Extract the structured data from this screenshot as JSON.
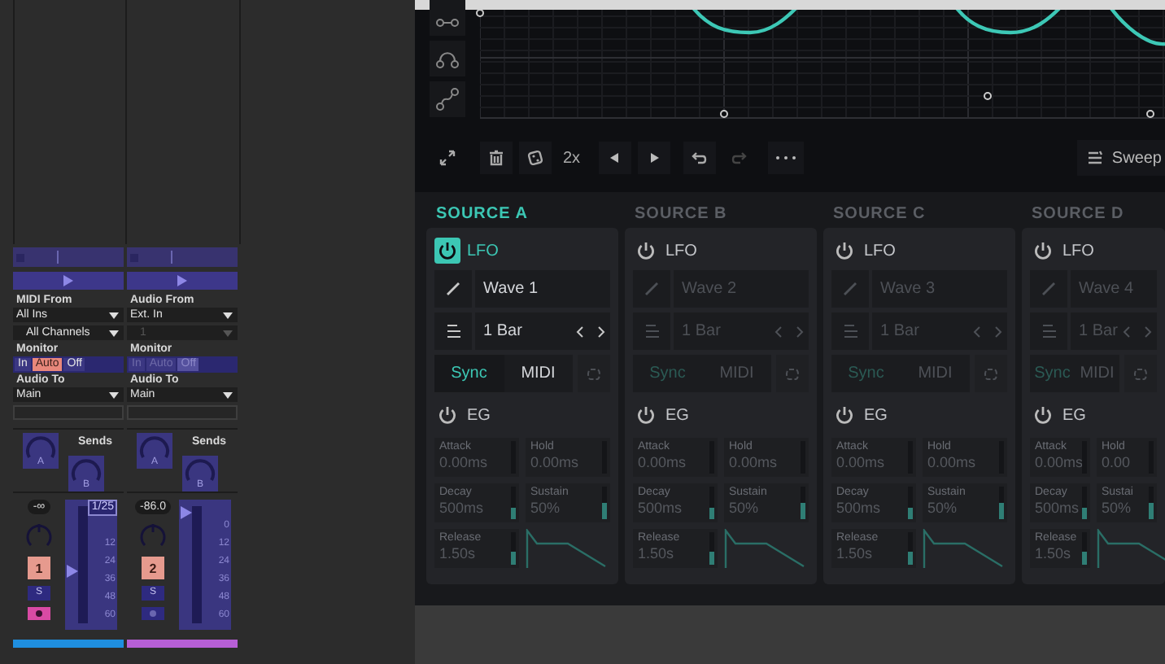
{
  "tracks": [
    {
      "input_label": "MIDI From",
      "input": "All Ins",
      "channel": {
        "text": "All Channels",
        "disabled": false
      },
      "monitor_label": "Monitor",
      "monitor_enabled": true,
      "monitor": [
        {
          "label": "In",
          "selected": false
        },
        {
          "label": "Auto",
          "selected": true
        },
        {
          "label": "Off",
          "selected": false
        }
      ],
      "output_label": "Audio To",
      "output": "Main",
      "sends_label": "Sends",
      "sends": [
        "A",
        "B"
      ],
      "volume": "-∞",
      "meter_readout": "1/25",
      "scale": [
        "12",
        "24",
        "36",
        "48",
        "60"
      ],
      "level": 0.45,
      "number": "1",
      "solo": "S",
      "armed": true,
      "color": "#1f8fe0"
    },
    {
      "input_label": "Audio From",
      "input": "Ext. In",
      "channel": {
        "text": "1",
        "disabled": true
      },
      "monitor_label": "Monitor",
      "monitor_enabled": false,
      "monitor": [
        {
          "label": "In",
          "selected": false
        },
        {
          "label": "Auto",
          "selected": false
        },
        {
          "label": "Off",
          "selected": true
        }
      ],
      "output_label": "Audio To",
      "output": "Main",
      "sends_label": "Sends",
      "sends": [
        "A",
        "B"
      ],
      "volume": "-86.0",
      "scale": [
        "0",
        "12",
        "24",
        "36",
        "48",
        "60"
      ],
      "level": 1.0,
      "number": "2",
      "solo": "S",
      "armed": false,
      "color": "#b75fd6"
    }
  ],
  "toolbar": {
    "multiplier": "2x",
    "preset": "Sweep"
  },
  "sources": [
    {
      "title": "SOURCE A",
      "active": true,
      "lfo": {
        "label": "LFO",
        "on": true
      },
      "wave": "Wave 1",
      "rate": "1 Bar",
      "sync": [
        {
          "label": "Sync",
          "selected": true
        },
        {
          "label": "MIDI",
          "selected": false
        }
      ],
      "eg": {
        "label": "EG",
        "on": false
      },
      "params": [
        {
          "label": "Attack",
          "value": "0.00ms",
          "level": 0
        },
        {
          "label": "Hold",
          "value": "0.00ms",
          "level": 0
        },
        {
          "label": "Decay",
          "value": "500ms",
          "level": 0.35
        },
        {
          "label": "Sustain",
          "value": "50%",
          "level": 0.5
        },
        {
          "label": "Release",
          "value": "1.50s",
          "level": 0.4
        }
      ]
    },
    {
      "title": "SOURCE B",
      "active": false,
      "lfo": {
        "label": "LFO",
        "on": false
      },
      "wave": "Wave 2",
      "rate": "1 Bar",
      "sync": [
        {
          "label": "Sync",
          "selected": true
        },
        {
          "label": "MIDI",
          "selected": false
        }
      ],
      "eg": {
        "label": "EG",
        "on": false
      },
      "params": [
        {
          "label": "Attack",
          "value": "0.00ms",
          "level": 0
        },
        {
          "label": "Hold",
          "value": "0.00ms",
          "level": 0
        },
        {
          "label": "Decay",
          "value": "500ms",
          "level": 0.35
        },
        {
          "label": "Sustain",
          "value": "50%",
          "level": 0.5
        },
        {
          "label": "Release",
          "value": "1.50s",
          "level": 0.4
        }
      ]
    },
    {
      "title": "SOURCE C",
      "active": false,
      "lfo": {
        "label": "LFO",
        "on": false
      },
      "wave": "Wave 3",
      "rate": "1 Bar",
      "sync": [
        {
          "label": "Sync",
          "selected": true
        },
        {
          "label": "MIDI",
          "selected": false
        }
      ],
      "eg": {
        "label": "EG",
        "on": false
      },
      "params": [
        {
          "label": "Attack",
          "value": "0.00ms",
          "level": 0
        },
        {
          "label": "Hold",
          "value": "0.00ms",
          "level": 0
        },
        {
          "label": "Decay",
          "value": "500ms",
          "level": 0.35
        },
        {
          "label": "Sustain",
          "value": "50%",
          "level": 0.5
        },
        {
          "label": "Release",
          "value": "1.50s",
          "level": 0.4
        }
      ]
    },
    {
      "title": "SOURCE D",
      "active": false,
      "lfo": {
        "label": "LFO",
        "on": false
      },
      "wave": "Wave 4",
      "rate": "1 Bar",
      "sync": [
        {
          "label": "Sync",
          "selected": true
        },
        {
          "label": "MIDI",
          "selected": false
        }
      ],
      "eg": {
        "label": "EG",
        "on": false
      },
      "params": [
        {
          "label": "Attack",
          "value": "0.00ms",
          "level": 0
        },
        {
          "label": "Hold",
          "value": "0.00",
          "level": 0
        },
        {
          "label": "Decay",
          "value": "500ms",
          "level": 0.35
        },
        {
          "label": "Sustai",
          "value": "50%",
          "level": 0.5
        },
        {
          "label": "Release",
          "value": "1.50s",
          "level": 0.4
        }
      ]
    }
  ]
}
